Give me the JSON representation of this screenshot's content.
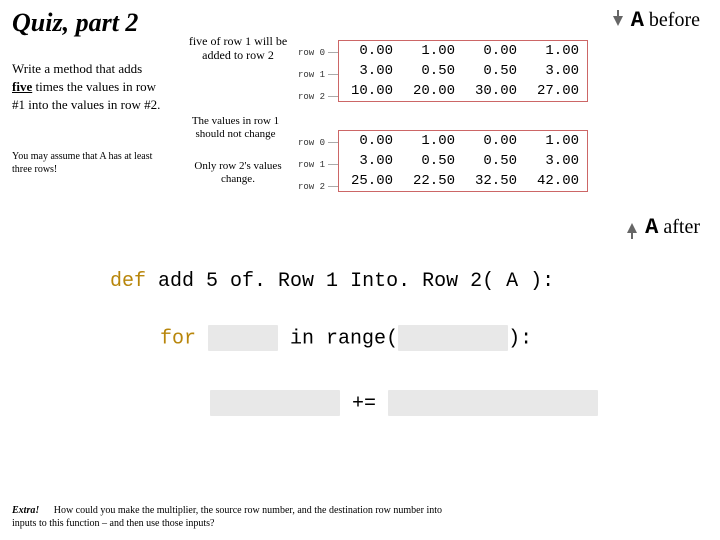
{
  "title": "Quiz, part 2",
  "instruction_pre": "Write a method that adds ",
  "instruction_five": "five",
  "instruction_post": " times the values in row #1 into the values in row #2.",
  "assume": "You may assume that A has at least three rows!",
  "note1": "five of row 1 will be added to row 2",
  "note2": "The values in row 1 should not change",
  "note3": "Only row 2's values change.",
  "rowlabels": [
    "row 0",
    "row 1",
    "row 2"
  ],
  "a_label": "A",
  "before_label": "before",
  "after_label": "after",
  "chart_data": [
    {
      "type": "table",
      "title": "A before",
      "rows": [
        [
          "0.00",
          "1.00",
          "0.00",
          "1.00"
        ],
        [
          "3.00",
          "0.50",
          "0.50",
          "3.00"
        ],
        [
          "10.00",
          "20.00",
          "30.00",
          "27.00"
        ]
      ]
    },
    {
      "type": "table",
      "title": "A after",
      "rows": [
        [
          "0.00",
          "1.00",
          "0.00",
          "1.00"
        ],
        [
          "3.00",
          "0.50",
          "0.50",
          "3.00"
        ],
        [
          "25.00",
          "22.50",
          "32.50",
          "42.00"
        ]
      ]
    }
  ],
  "code": {
    "def": "def",
    "fn": "add 5 of. Row 1 Into. Row 2( A ):",
    "for": "for",
    "in_range": "in range(",
    "close": "):",
    "pluseq": "+="
  },
  "extra_label": "Extra!",
  "extra_text": "How could you make the multiplier, the source row number, and the destination row number into inputs to this function – and then use those inputs?"
}
